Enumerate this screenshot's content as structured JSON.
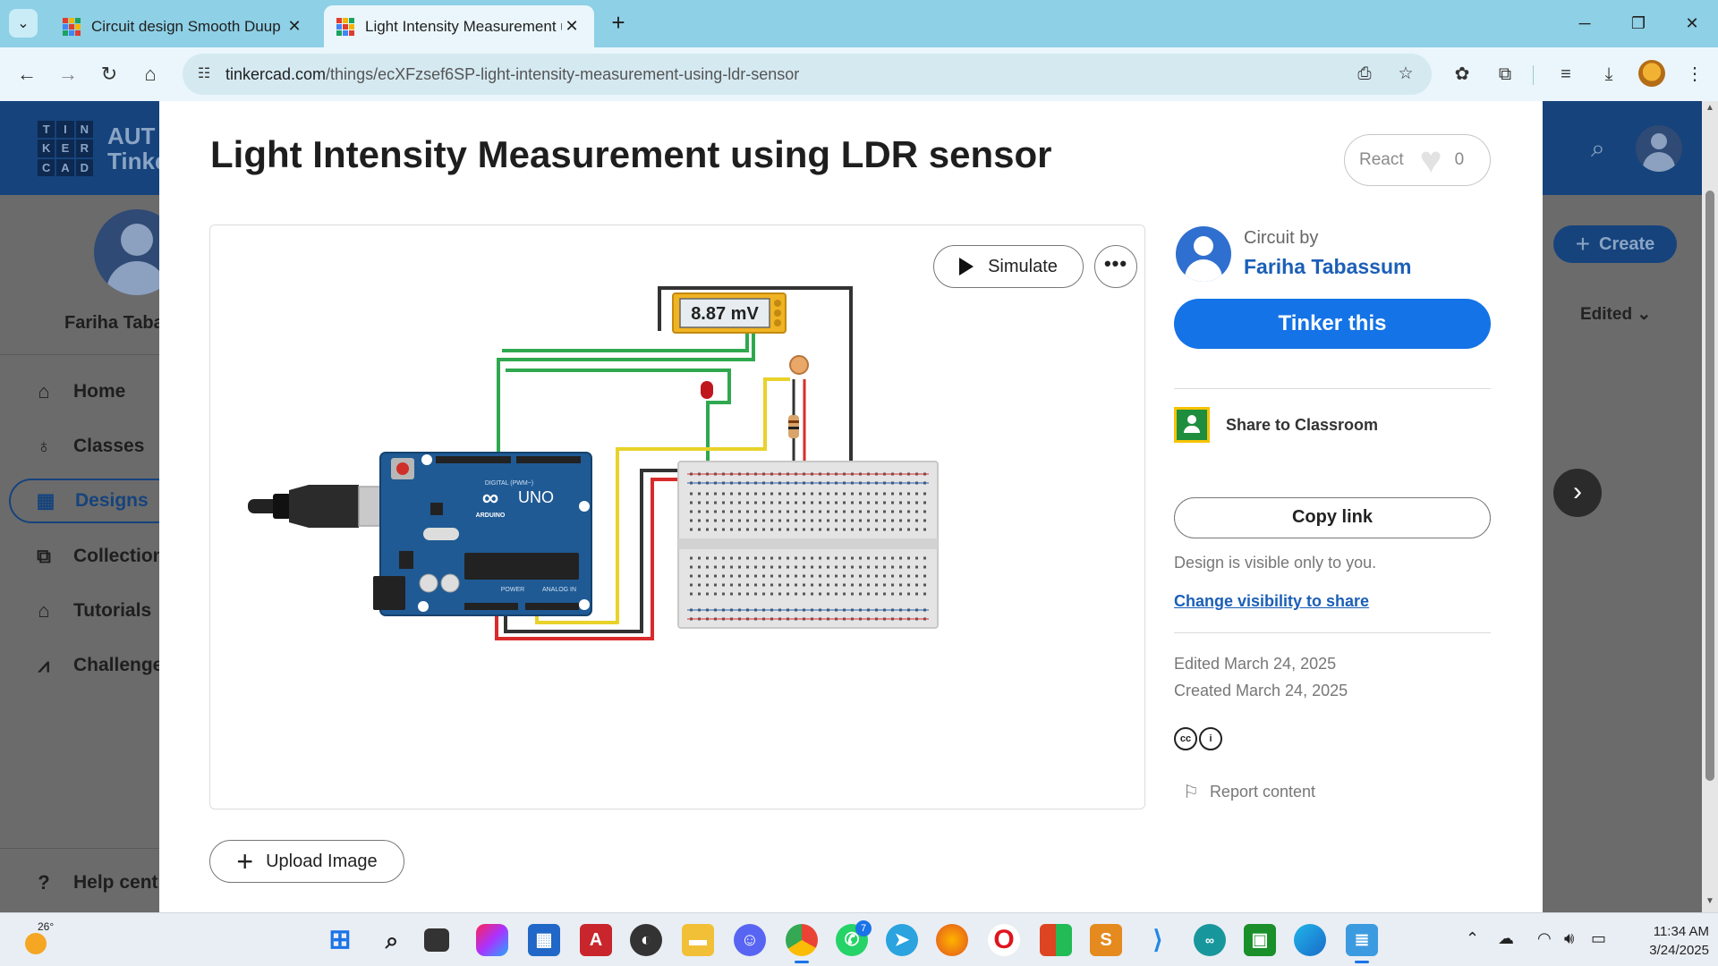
{
  "browser": {
    "tabs": [
      {
        "title": "Circuit design Smooth Duup - T",
        "active": false
      },
      {
        "title": "Light Intensity Measurement us",
        "active": true
      }
    ],
    "url_host": "tinkercad.com",
    "url_path": "/things/ecXFzsef6SP-light-intensity-measurement-using-ldr-sensor"
  },
  "background_page": {
    "brand": "AUT",
    "brand2": "Tinke",
    "logo_letters": [
      "T",
      "I",
      "N",
      "K",
      "E",
      "R",
      "C",
      "A",
      "D"
    ],
    "username": "Fariha Taba",
    "nav": [
      {
        "label": "Home",
        "icon": "home-icon"
      },
      {
        "label": "Classes",
        "icon": "apple-icon"
      },
      {
        "label": "Designs",
        "icon": "grid-icon"
      },
      {
        "label": "Collection",
        "icon": "collection-icon"
      },
      {
        "label": "Tutorials",
        "icon": "graduation-cap-icon"
      },
      {
        "label": "Challenge",
        "icon": "chart-icon"
      },
      {
        "label": "Help cent",
        "icon": "help-icon"
      }
    ],
    "create_label": "Create",
    "sort_label": "Edited",
    "sort_prefix": "t"
  },
  "modal": {
    "title": "Light Intensity Measurement using LDR sensor",
    "react_label": "React",
    "react_count": "0",
    "simulate_label": "Simulate",
    "more_label": "•••",
    "upload_label": "Upload Image",
    "circuit": {
      "meter_reading": "8.87 mV",
      "board_label": "UNO",
      "board_brand": "ARDUINO",
      "digital_label": "DIGITAL (PWM~)",
      "power_label": "POWER",
      "analog_label": "ANALOG IN"
    },
    "author": {
      "by_label": "Circuit by",
      "name": "Fariha Tabassum"
    },
    "tinker_label": "Tinker this",
    "classroom_label": "Share to Classroom",
    "copy_label": "Copy link",
    "visibility_note": "Design is visible only to you.",
    "visibility_link": "Change visibility to share",
    "edited": "Edited March 24, 2025",
    "created": "Created March 24, 2025",
    "report_label": "Report content"
  },
  "taskbar": {
    "temperature": "26°",
    "whatsapp_badge": "7",
    "time": "11:34 AM",
    "date": "3/24/2025"
  },
  "colors": {
    "brand_blue": "#1473e6",
    "link_blue": "#1b5fb7",
    "header_navy": "#16437c",
    "arduino_teal": "#1f5a94"
  }
}
